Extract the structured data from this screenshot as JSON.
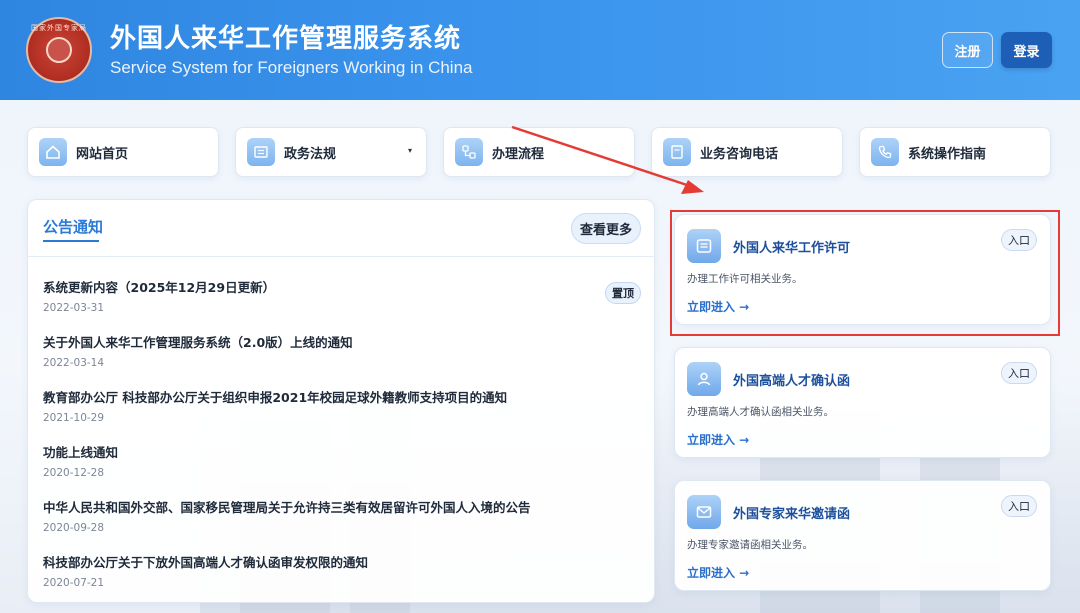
{
  "header": {
    "title_cn": "外国人来华工作管理服务系统",
    "title_en": "Service System for Foreigners Working in China",
    "logo_text": "国家外国专家局",
    "register_label": "注册",
    "login_label": "登录"
  },
  "nav": [
    {
      "label": "网站首页",
      "icon": "home-icon"
    },
    {
      "label": "政务法规",
      "icon": "document-list-icon",
      "caret": "▾"
    },
    {
      "label": "办理流程",
      "icon": "flow-icon"
    },
    {
      "label": "业务咨询电话",
      "icon": "note-icon"
    },
    {
      "label": "系统操作指南",
      "icon": "phone-icon"
    }
  ],
  "announcements": {
    "title": "公告通知",
    "more_label": "查看更多",
    "pin_label": "置顶",
    "items": [
      {
        "title": "系统更新内容（2025年12月29日更新）",
        "date": "2022-03-31",
        "pinned": true
      },
      {
        "title": "关于外国人来华工作管理服务系统（2.0版）上线的通知",
        "date": "2022-03-14"
      },
      {
        "title": "教育部办公厅 科技部办公厅关于组织申报2021年校园足球外籍教师支持项目的通知",
        "date": "2021-10-29"
      },
      {
        "title": "功能上线通知",
        "date": "2020-12-28"
      },
      {
        "title": "中华人民共和国外交部、国家移民管理局关于允许持三类有效居留许可外国人入境的公告",
        "date": "2020-09-28"
      },
      {
        "title": "科技部办公厅关于下放外国高端人才确认函审发权限的通知",
        "date": "2020-07-21"
      }
    ]
  },
  "services": [
    {
      "title": "外国人来华工作许可",
      "desc": "办理工作许可相关业务。",
      "link": "立即进入 →",
      "entry": "入口",
      "icon": "document-icon",
      "highlighted": true
    },
    {
      "title": "外国高端人才确认函",
      "desc": "办理高端人才确认函相关业务。",
      "link": "立即进入 →",
      "entry": "入口",
      "icon": "person-icon"
    },
    {
      "title": "外国专家来华邀请函",
      "desc": "办理专家邀请函相关业务。",
      "link": "立即进入 →",
      "entry": "入口",
      "icon": "mail-icon"
    }
  ],
  "colors": {
    "header": "#3a93ec",
    "accent": "#2a7ad6",
    "annotation": "#e53b35"
  }
}
